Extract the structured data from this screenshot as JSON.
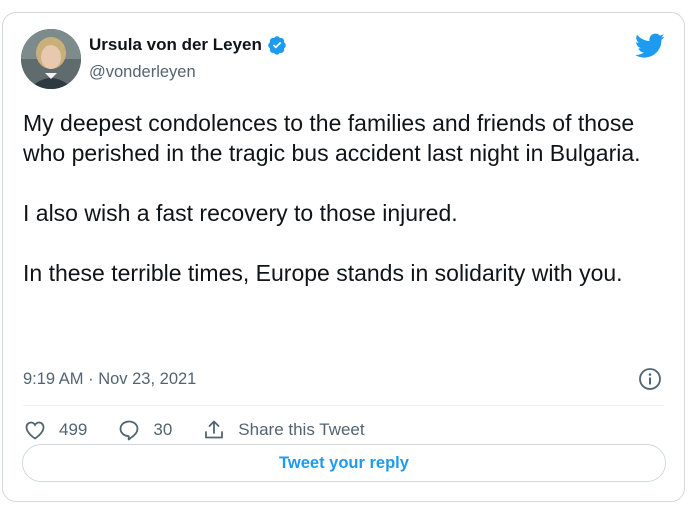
{
  "author": {
    "name": "Ursula von der Leyen",
    "handle": "@vonderleyen",
    "avatar_icon": "profile-photo"
  },
  "tweet": {
    "paragraphs": [
      "My deepest condolences to the families and friends of those who perished in the tragic bus accident last night in Bulgaria.",
      "I also wish a fast recovery to those injured.",
      "In these terrible times, Europe stands in solidarity with you."
    ],
    "timestamp": "9:19 AM · Nov 23, 2021"
  },
  "actions": {
    "likes": "499",
    "replies": "30",
    "share_label": "Share this Tweet"
  },
  "reply_button": {
    "label": "Tweet your reply"
  },
  "colors": {
    "accent": "#1d9bf0",
    "text_primary": "#0f1419",
    "text_secondary": "#536471",
    "border": "#cfd9de"
  },
  "icons": [
    "verified-badge-icon",
    "twitter-bird-icon",
    "info-icon",
    "heart-icon",
    "reply-bubble-icon",
    "share-icon"
  ]
}
